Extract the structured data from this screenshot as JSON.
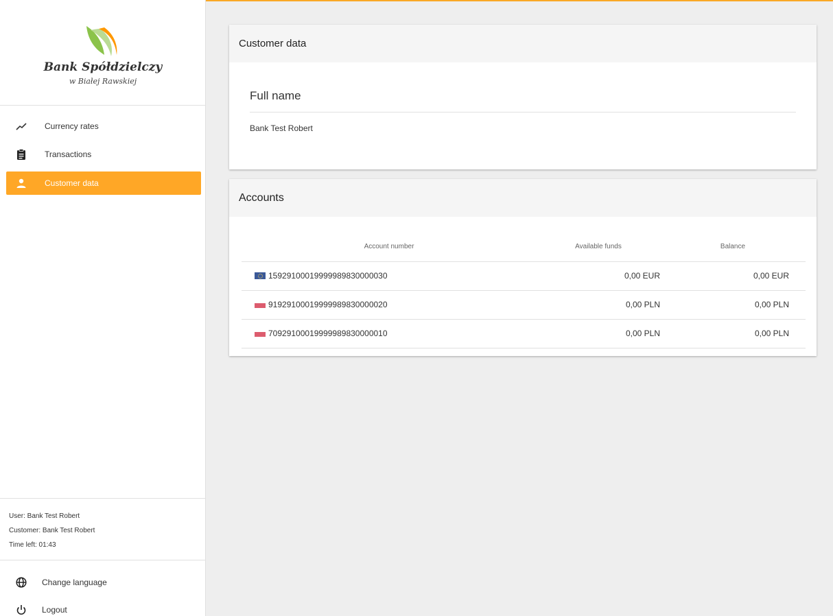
{
  "brand": {
    "name": "Bank Spółdzielczy",
    "subtitle": "w Białej Rawskiej",
    "accent": "#ffa726",
    "leaf_green": "#8bc34a",
    "leaf_orange": "#ff9800"
  },
  "nav": {
    "items": [
      {
        "label": "Currency rates",
        "icon": "trending-up-icon"
      },
      {
        "label": "Transactions",
        "icon": "clipboard-icon"
      },
      {
        "label": "Customer data",
        "icon": "person-icon",
        "active": true
      }
    ]
  },
  "session": {
    "user": "User: Bank Test Robert",
    "customer": "Customer: Bank Test Robert",
    "time_left": "Time left: 01:43"
  },
  "actions": {
    "change_language": "Change language",
    "logout": "Logout"
  },
  "customer_card": {
    "title": "Customer data",
    "field_label": "Full name",
    "field_value": "Bank Test Robert"
  },
  "accounts_card": {
    "title": "Accounts",
    "columns": [
      "Account number",
      "Available funds",
      "Balance"
    ],
    "rows": [
      {
        "flag": "eur",
        "number": "15929100019999989830000030",
        "available": "0,00 EUR",
        "balance": "0,00 EUR"
      },
      {
        "flag": "pln",
        "number": "91929100019999989830000020",
        "available": "0,00 PLN",
        "balance": "0,00 PLN"
      },
      {
        "flag": "pln",
        "number": "70929100019999989830000010",
        "available": "0,00 PLN",
        "balance": "0,00 PLN"
      }
    ]
  }
}
